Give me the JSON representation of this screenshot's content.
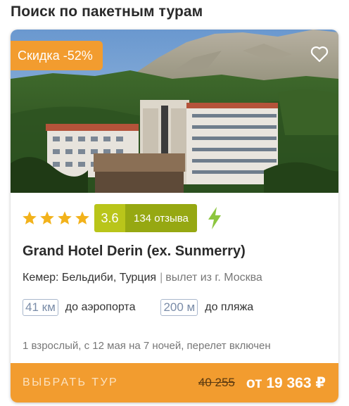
{
  "page": {
    "title": "Поиск по пакетным турам"
  },
  "card": {
    "discount": "Скидка -52%",
    "rating": {
      "stars": 4,
      "score": "3.6",
      "reviews": "134 отзыва"
    },
    "hotel_name": "Grand Hotel Derin (ex. Sunmerry)",
    "location": "Кемер: Бельдиби, Турция",
    "separator": "|",
    "departure": "вылет из г. Москва",
    "distances": [
      {
        "value": "41 км",
        "label": "до аэропорта"
      },
      {
        "value": "200 м",
        "label": "до пляжа"
      }
    ],
    "tour_details": "1 взрослый, с 12 мая на 7 ночей, перелет включен",
    "footer": {
      "select_label": "ВЫБРАТЬ ТУР",
      "old_price": "40 255",
      "new_price": "от 19 363 ₽"
    },
    "icons": {
      "favorite": "heart-outline-icon",
      "star": "star-icon",
      "instant": "lightning-bolt-icon"
    },
    "colors": {
      "accent_orange": "#f29c2f",
      "rating_score_bg": "#b9c51a",
      "rating_reviews_bg": "#96a812",
      "star_color": "#f2b21b",
      "bolt_color": "#8dc63f"
    }
  }
}
